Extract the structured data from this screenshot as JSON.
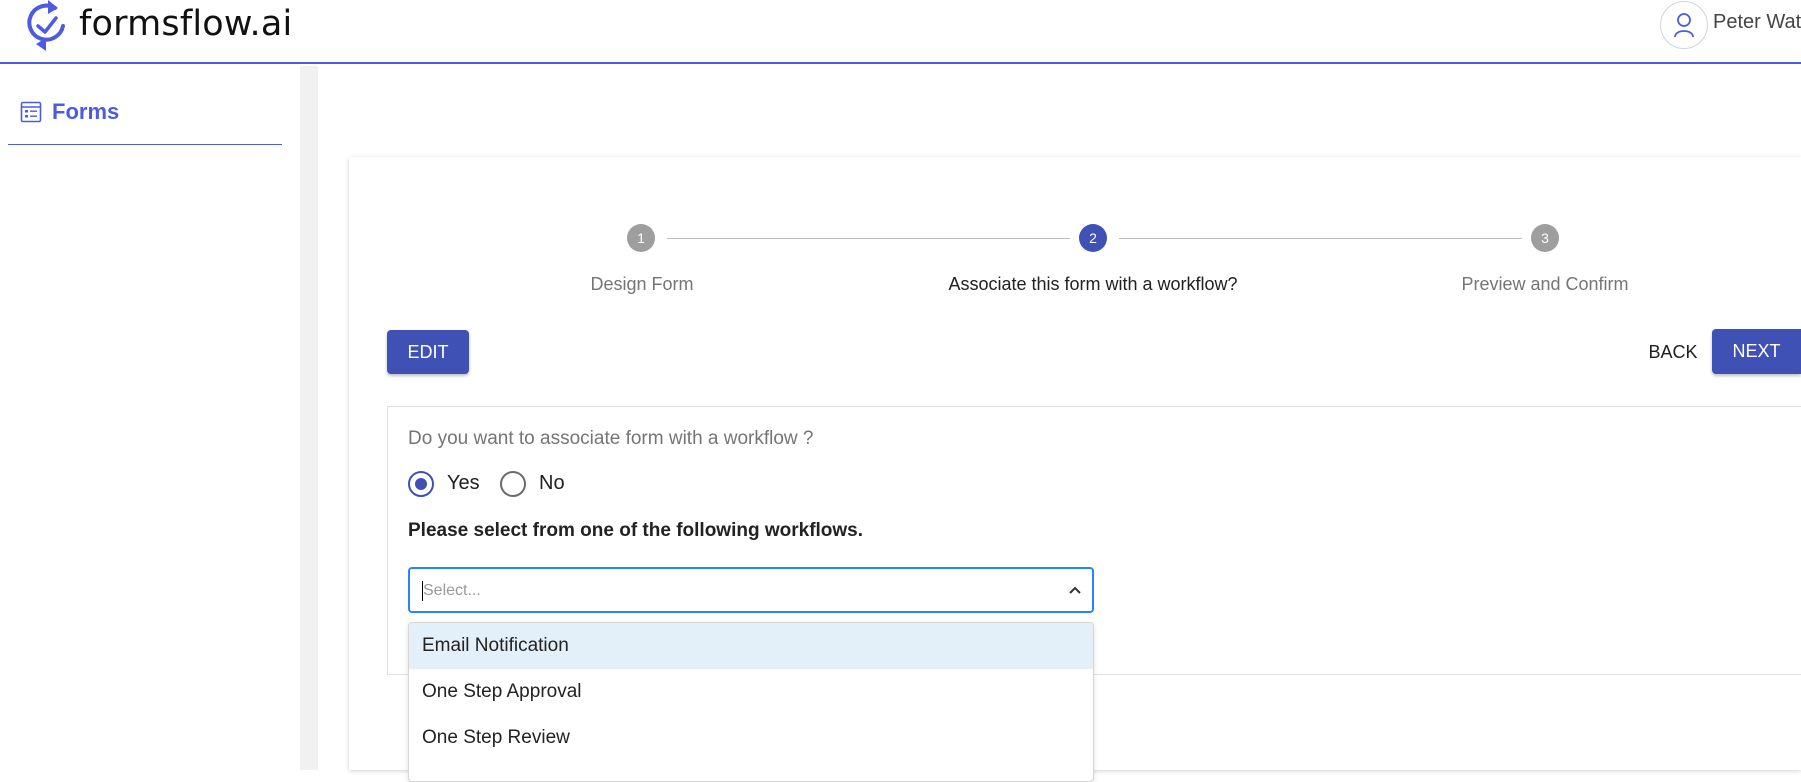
{
  "header": {
    "brand": "formsflow.ai",
    "user_name": "Peter Wat",
    "accent_color": "#4d5be0"
  },
  "sidebar": {
    "items": [
      {
        "label": "Forms",
        "icon": "form-list-icon"
      }
    ]
  },
  "stepper": {
    "steps": [
      {
        "number": "1",
        "label": "Design Form",
        "state": "inactive"
      },
      {
        "number": "2",
        "label": "Associate this form with a workflow?",
        "state": "active"
      },
      {
        "number": "3",
        "label": "Preview and Confirm",
        "state": "inactive"
      }
    ],
    "active_color": "#3f51b5",
    "inactive_color": "#9e9e9e"
  },
  "actions": {
    "edit_label": "EDIT",
    "back_label": "BACK",
    "next_label": "NEXT"
  },
  "workflow": {
    "question": "Do you want to associate form with a workflow ?",
    "options": [
      {
        "label": "Yes",
        "checked": true
      },
      {
        "label": "No",
        "checked": false
      }
    ],
    "instruction": "Please select from one of the following workflows.",
    "select": {
      "placeholder": "Select...",
      "value": ""
    },
    "dropdown_options": [
      {
        "label": "Email Notification",
        "focused": true
      },
      {
        "label": "One Step Approval",
        "focused": false
      },
      {
        "label": "One Step Review",
        "focused": false
      }
    ]
  }
}
